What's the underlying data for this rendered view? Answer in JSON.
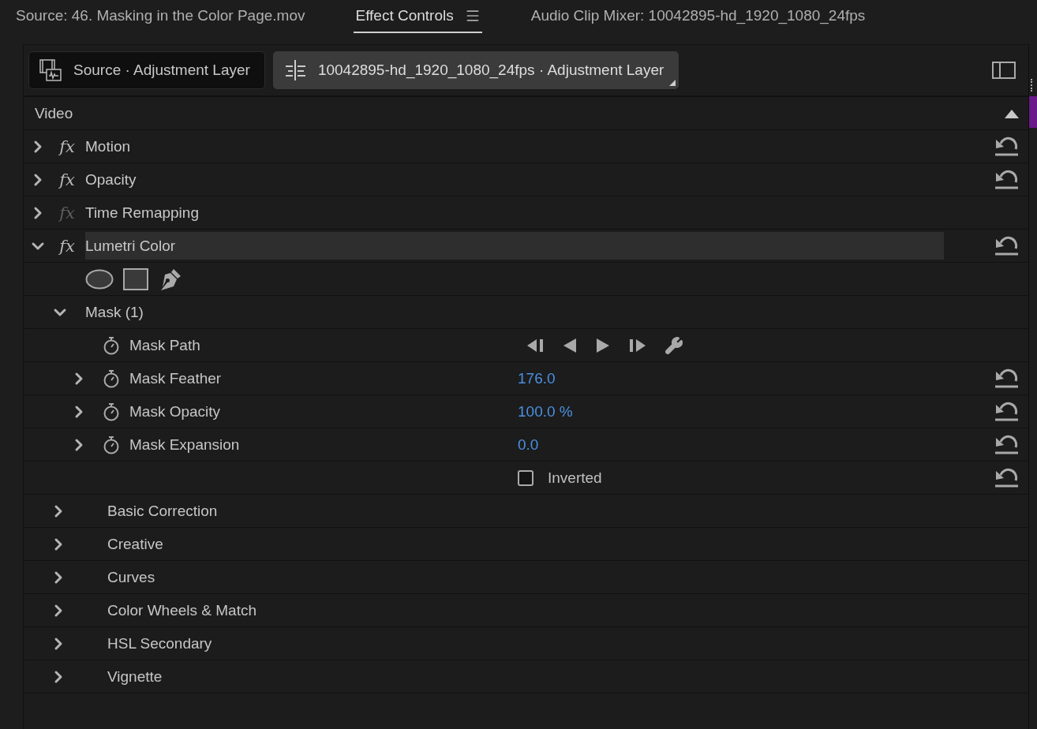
{
  "header_tabs": [
    {
      "label": "Source: 46. Masking in the Color Page.mov",
      "selected": false
    },
    {
      "label": "Effect Controls",
      "selected": true,
      "has_menu": true
    },
    {
      "label": "Audio Clip Mixer: 10042895-hd_1920_1080_24fps",
      "selected": false
    }
  ],
  "clip_tabs": [
    {
      "label": "Source · Adjustment Layer",
      "selected": false,
      "kind": "source"
    },
    {
      "label": "10042895-hd_1920_1080_24fps · Adjustment Layer",
      "selected": true,
      "kind": "sequence"
    }
  ],
  "section": {
    "label": "Video",
    "expanded": true
  },
  "effects": [
    {
      "name": "Motion",
      "fx": "fx",
      "expanded": false,
      "enabled": true,
      "selected": false,
      "resettable": true
    },
    {
      "name": "Opacity",
      "fx": "fx",
      "expanded": false,
      "enabled": true,
      "selected": false,
      "resettable": true
    },
    {
      "name": "Time Remapping",
      "fx": "fx",
      "expanded": false,
      "enabled": false,
      "selected": false,
      "resettable": false
    },
    {
      "name": "Lumetri Color",
      "fx": "fx",
      "expanded": true,
      "enabled": true,
      "selected": true,
      "resettable": true,
      "mask": {
        "label": "Mask (1)",
        "expanded": true,
        "properties": [
          {
            "kind": "keyframes",
            "name": "Mask Path",
            "expandable": false,
            "resettable": false
          },
          {
            "kind": "value",
            "name": "Mask Feather",
            "value": "176.0",
            "expandable": true,
            "resettable": true
          },
          {
            "kind": "value",
            "name": "Mask Opacity",
            "value": "100.0 %",
            "expandable": true,
            "resettable": true
          },
          {
            "kind": "value",
            "name": "Mask Expansion",
            "value": "0.0",
            "expandable": true,
            "resettable": true
          },
          {
            "kind": "checkbox",
            "label": "Inverted",
            "checked": false,
            "resettable": true
          }
        ]
      },
      "subsections": [
        {
          "name": "Basic Correction",
          "expanded": false
        },
        {
          "name": "Creative",
          "expanded": false
        },
        {
          "name": "Curves",
          "expanded": false
        },
        {
          "name": "Color Wheels & Match",
          "expanded": false
        },
        {
          "name": "HSL Secondary",
          "expanded": false
        },
        {
          "name": "Vignette",
          "expanded": false
        }
      ]
    }
  ]
}
